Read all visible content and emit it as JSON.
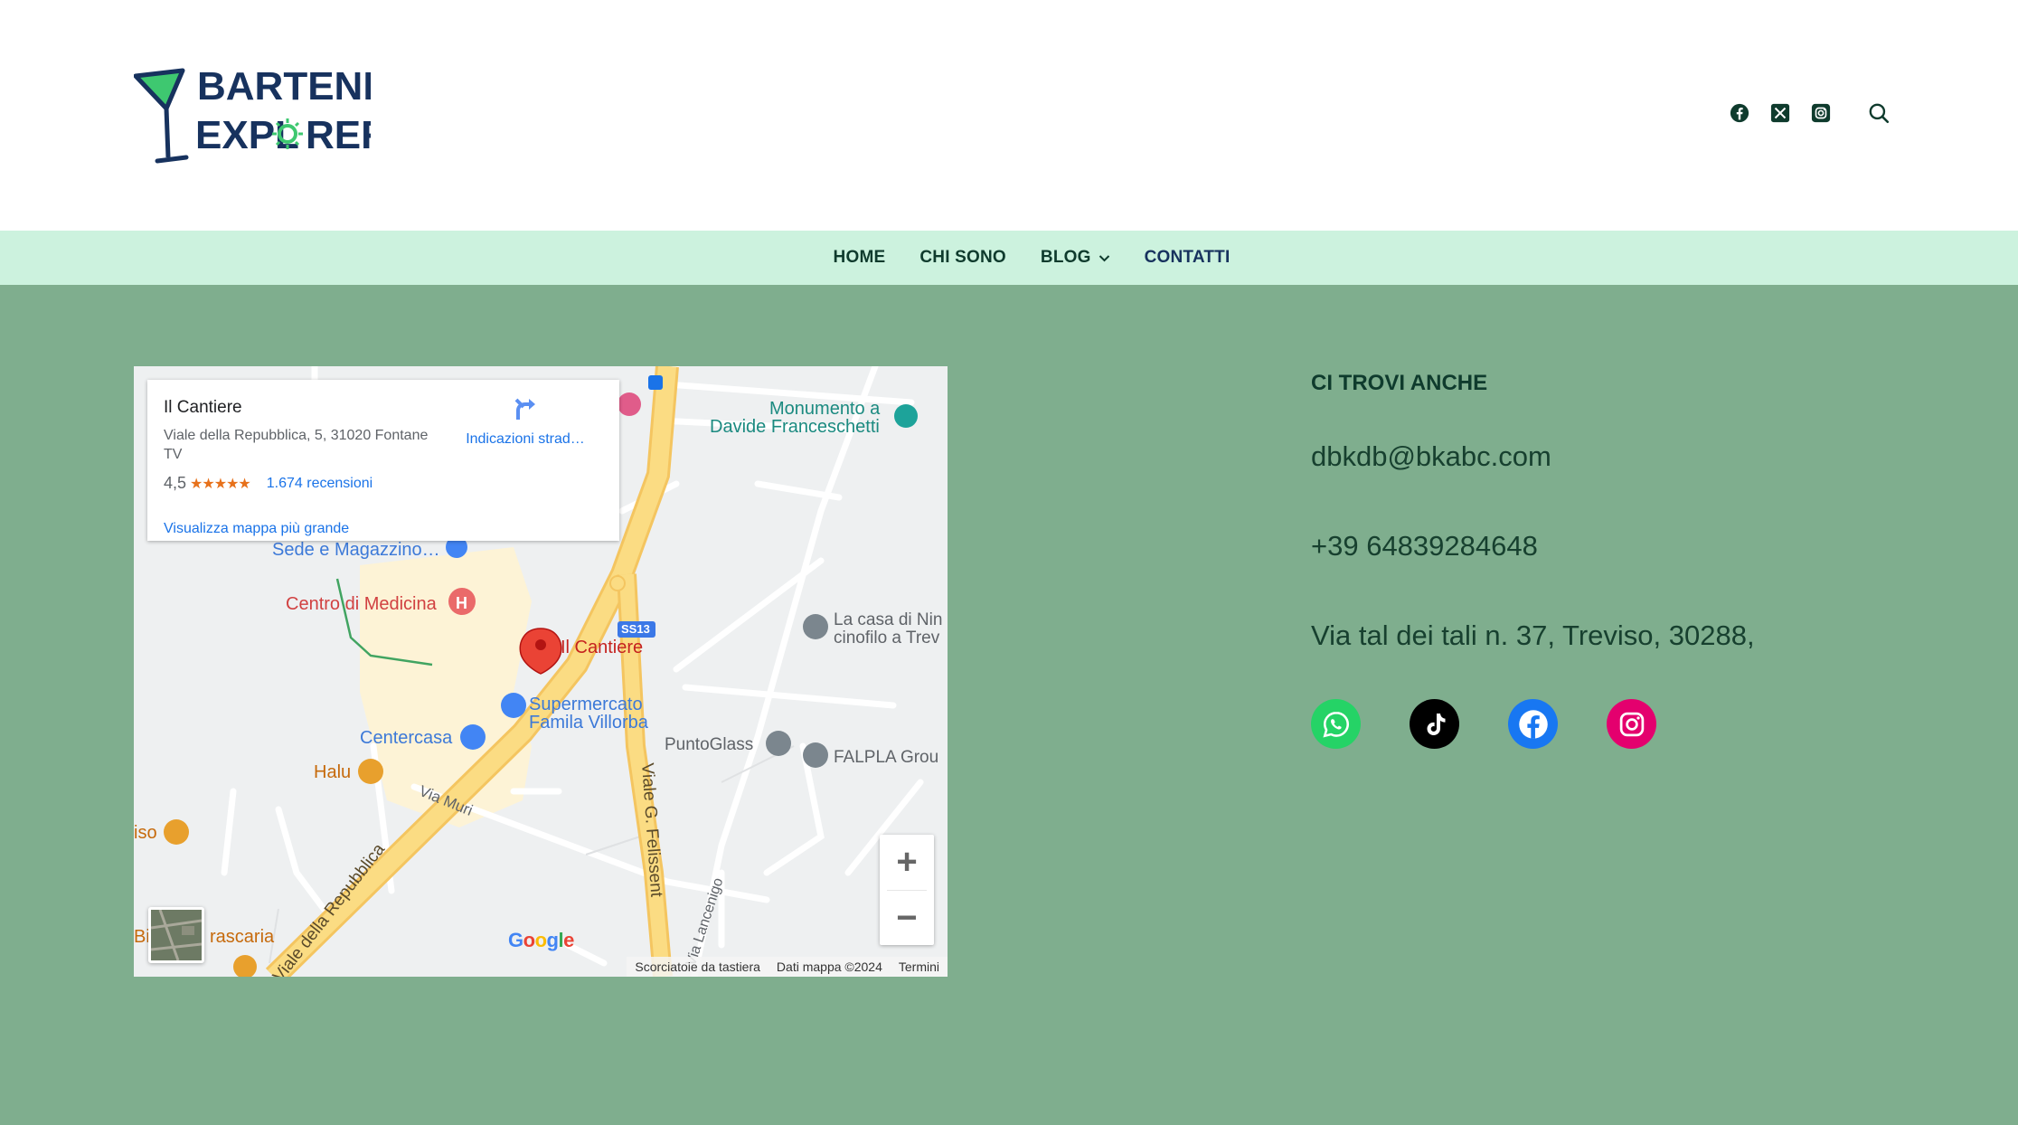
{
  "header": {
    "logo_line1": "BARTENDER",
    "logo_line2_a": "EXPL",
    "logo_line2_b": "RER",
    "icons": [
      "facebook-icon",
      "x-twitter-icon",
      "instagram-icon",
      "search-icon"
    ]
  },
  "nav": {
    "items": [
      {
        "label": "HOME"
      },
      {
        "label": "CHI SONO"
      },
      {
        "label": "BLOG"
      },
      {
        "label": "CONTATTI"
      }
    ]
  },
  "map": {
    "card": {
      "name": "Il Cantiere",
      "address": "Viale della Repubblica, 5, 31020 Fontane TV",
      "rating": "4,5",
      "stars": "★★★★★",
      "reviews": "1.674 recensioni",
      "bigger_map": "Visualizza mappa più grande",
      "directions": "Indicazioni strad…"
    },
    "labels": {
      "monumento_1": "Monumento a",
      "monumento_2": "Davide Franceschetti",
      "sede": "Sede e Magazzino…",
      "centro": "Centro di Medicina",
      "cantiere": "Il Cantiere",
      "ss13": "SS13",
      "casa_1": "La casa di Nin",
      "casa_2": "cinofilo a Trev",
      "super_1": "Supermercato",
      "super_2": "Famila Villorba",
      "centercasa": "Centercasa",
      "puntoglass": "PuntoGlass",
      "falpla": "FALPLA Grou",
      "halu": "Halu",
      "via_muri": "Via Muri",
      "iso": "iso",
      "viale_repubblica": "Viale della Repubblica",
      "viale_felissent": "Viale G. Felissent",
      "via_lancenigo": "Via Lancenigo",
      "bi": "Bi",
      "rascaria": "rascaria"
    },
    "google": "Google",
    "attribution": {
      "shortcuts": "Scorciatoie da tastiera",
      "data": "Dati mappa ©2024",
      "terms": "Termini"
    },
    "zoom_in": "+",
    "zoom_out": "−"
  },
  "contact": {
    "heading": "CI TROVI ANCHE",
    "email": "dbkdb@bkabc.com",
    "phone": "+39 64839284648",
    "address": "Via tal dei tali n. 37, Treviso, 30288,"
  },
  "socials": [
    {
      "name": "whatsapp-icon",
      "color": "#25d366"
    },
    {
      "name": "tiktok-icon",
      "color": "#000000"
    },
    {
      "name": "facebook-icon",
      "color": "#1877f2"
    },
    {
      "name": "instagram-icon",
      "color": "#e4006e"
    }
  ],
  "colors": {
    "page_bg": "#7fae8e",
    "nav_bg": "#ccf2de",
    "heading_text": "#0f3b2d",
    "logo_blue": "#17325e",
    "logo_green": "#3ec870"
  }
}
